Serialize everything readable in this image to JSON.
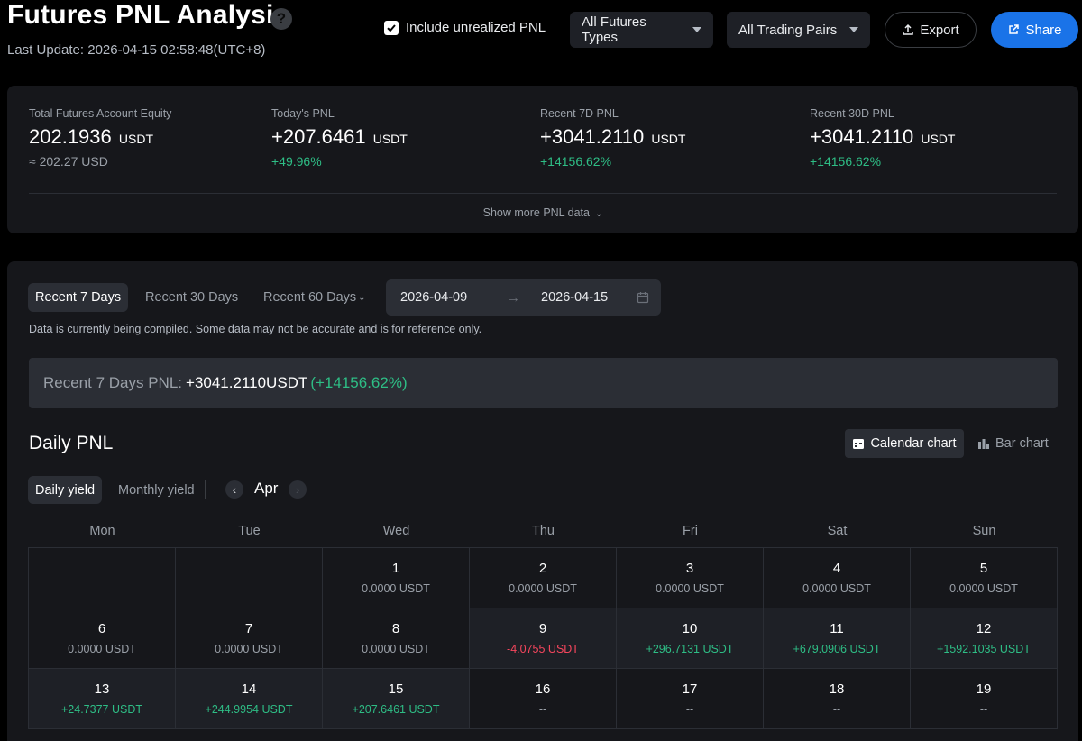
{
  "header": {
    "title": "Futures PNL Analysis",
    "help_icon": "?",
    "last_update": "Last Update: 2026-04-15 02:58:48(UTC+8)",
    "include_unrealized_label": "Include unrealized PNL",
    "include_unrealized_checked": true,
    "futures_type_select": "All Futures Types",
    "trading_pairs_select": "All Trading Pairs",
    "export_label": "Export",
    "share_label": "Share"
  },
  "stats": [
    {
      "label": "Total Futures Account Equity",
      "value": "202.1936",
      "unit": "USDT",
      "sub": "≈ 202.27 USD"
    },
    {
      "label": "Today's PNL",
      "value": "+207.6461",
      "unit": "USDT",
      "sub": "+49.96%"
    },
    {
      "label": "Recent 7D PNL",
      "value": "+3041.2110",
      "unit": "USDT",
      "sub": "+14156.62%"
    },
    {
      "label": "Recent 30D PNL",
      "value": "+3041.2110",
      "unit": "USDT",
      "sub": "+14156.62%"
    }
  ],
  "show_more": "Show more PNL data",
  "range_tabs": [
    "Recent 7 Days",
    "Recent 30 Days",
    "Recent 60 Days"
  ],
  "date_range": {
    "start": "2026-04-09",
    "end": "2026-04-15"
  },
  "note": "Data is currently being compiled. Some data may not be accurate and is for reference only.",
  "summary": {
    "label": "Recent 7 Days PNL:",
    "value": "+3041.2110",
    "unit": "USDT",
    "pct": "(+14156.62%)"
  },
  "daily": {
    "title": "Daily PNL",
    "calendar_chart_label": "Calendar chart",
    "bar_chart_label": "Bar chart",
    "daily_yield_label": "Daily yield",
    "monthly_yield_label": "Monthly yield",
    "month": "Apr",
    "weekdays": [
      "Mon",
      "Tue",
      "Wed",
      "Thu",
      "Fri",
      "Sat",
      "Sun"
    ],
    "weeks": [
      [
        {
          "day": "",
          "pnl": ""
        },
        {
          "day": "",
          "pnl": ""
        },
        {
          "day": "1",
          "pnl": "0.0000 USDT"
        },
        {
          "day": "2",
          "pnl": "0.0000 USDT"
        },
        {
          "day": "3",
          "pnl": "0.0000 USDT"
        },
        {
          "day": "4",
          "pnl": "0.0000 USDT"
        },
        {
          "day": "5",
          "pnl": "0.0000 USDT"
        }
      ],
      [
        {
          "day": "6",
          "pnl": "0.0000 USDT"
        },
        {
          "day": "7",
          "pnl": "0.0000 USDT"
        },
        {
          "day": "8",
          "pnl": "0.0000 USDT"
        },
        {
          "day": "9",
          "pnl": "-4.0755 USDT"
        },
        {
          "day": "10",
          "pnl": "+296.7131 USDT"
        },
        {
          "day": "11",
          "pnl": "+679.0906 USDT"
        },
        {
          "day": "12",
          "pnl": "+1592.1035 USDT"
        }
      ],
      [
        {
          "day": "13",
          "pnl": "+24.7377 USDT"
        },
        {
          "day": "14",
          "pnl": "+244.9954 USDT"
        },
        {
          "day": "15",
          "pnl": "+207.6461 USDT"
        },
        {
          "day": "16",
          "pnl": "--"
        },
        {
          "day": "17",
          "pnl": "--"
        },
        {
          "day": "18",
          "pnl": "--"
        },
        {
          "day": "19",
          "pnl": "--"
        }
      ]
    ]
  }
}
